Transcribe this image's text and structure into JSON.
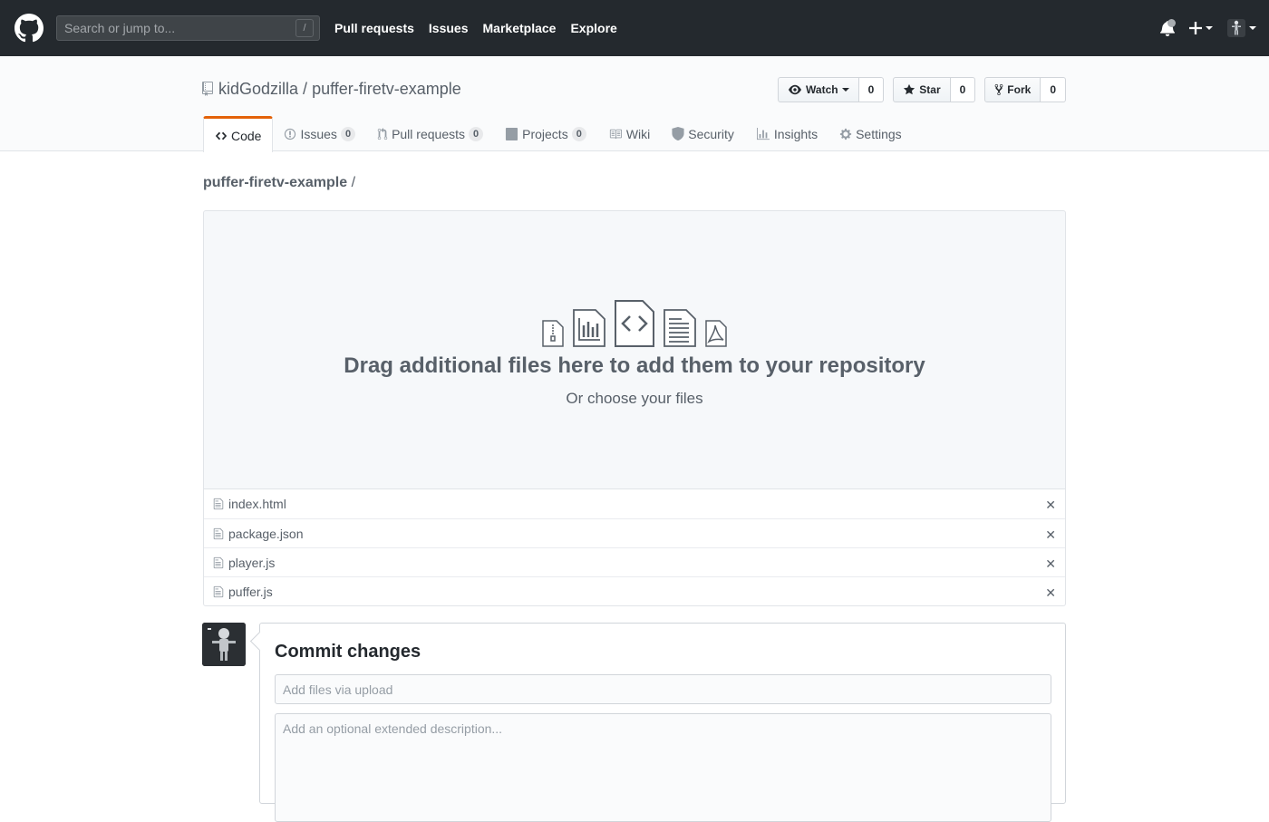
{
  "header": {
    "search_placeholder": "Search or jump to...",
    "search_shortcut": "/",
    "nav": [
      "Pull requests",
      "Issues",
      "Marketplace",
      "Explore"
    ]
  },
  "repo": {
    "owner": "kidGodzilla",
    "separator": "/",
    "name": "puffer-firetv-example",
    "watch_label": "Watch",
    "watch_count": "0",
    "star_label": "Star",
    "star_count": "0",
    "fork_label": "Fork",
    "fork_count": "0"
  },
  "tabs": [
    {
      "label": "Code",
      "icon": "code-icon",
      "count": null,
      "selected": true
    },
    {
      "label": "Issues",
      "icon": "issue-icon",
      "count": "0"
    },
    {
      "label": "Pull requests",
      "icon": "pull-request-icon",
      "count": "0"
    },
    {
      "label": "Projects",
      "icon": "project-icon",
      "count": "0"
    },
    {
      "label": "Wiki",
      "icon": "book-icon",
      "count": null
    },
    {
      "label": "Security",
      "icon": "shield-icon",
      "count": null
    },
    {
      "label": "Insights",
      "icon": "graph-icon",
      "count": null
    },
    {
      "label": "Settings",
      "icon": "gear-icon",
      "count": null
    }
  ],
  "breadcrumb": {
    "repo": "puffer-firetv-example",
    "trail": " /"
  },
  "dropzone": {
    "title": "Drag additional files here to add them to your repository",
    "subtitle": "Or choose your files"
  },
  "files": [
    "index.html",
    "package.json",
    "player.js",
    "puffer.js"
  ],
  "commit": {
    "title": "Commit changes",
    "summary_placeholder": "Add files via upload",
    "description_placeholder": "Add an optional extended description..."
  }
}
